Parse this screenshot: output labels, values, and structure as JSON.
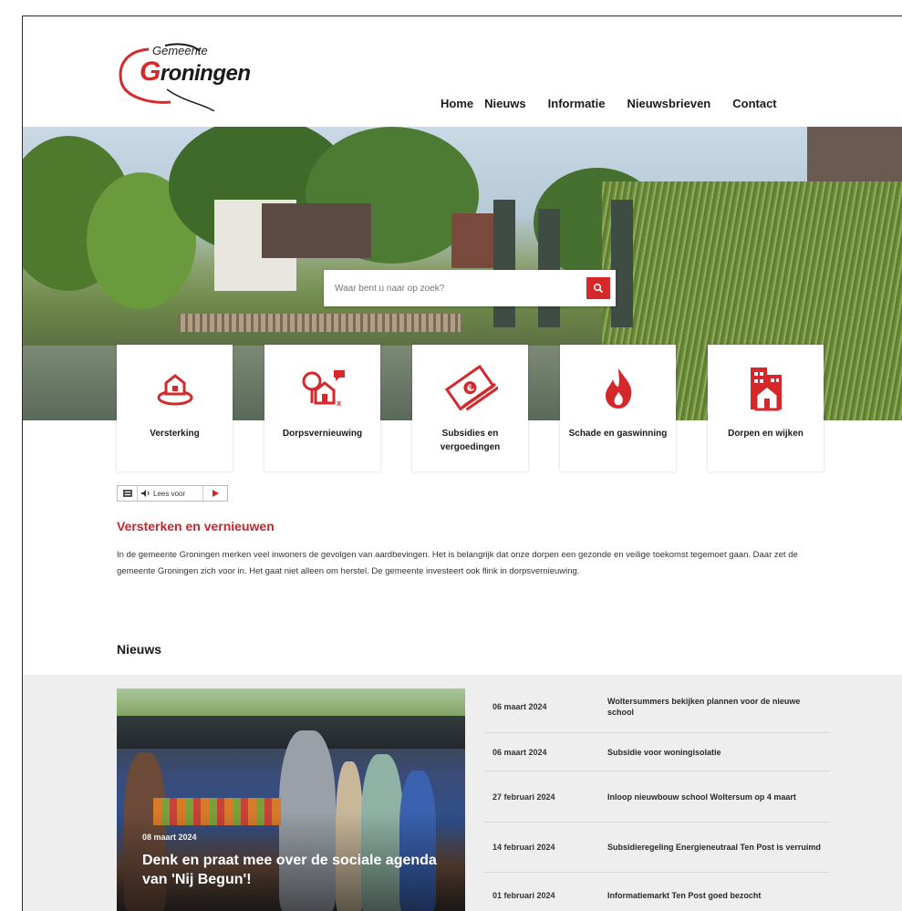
{
  "logo": {
    "sub": "Gemeente",
    "main_first": "G",
    "main_rest": "roningen"
  },
  "nav": [
    "Home",
    "Nieuws",
    "Informatie",
    "Nieuwsbrieven",
    "Contact"
  ],
  "search": {
    "placeholder": "Waar bent u naar op zoek?"
  },
  "tiles": [
    {
      "label": "Versterking",
      "icon": "house-shield-icon"
    },
    {
      "label": "Dorpsvernieuwing",
      "icon": "village-renewal-icon"
    },
    {
      "label": "Subsidies en vergoedingen",
      "icon": "euro-money-icon"
    },
    {
      "label": "Schade en gaswinning",
      "icon": "flame-icon"
    },
    {
      "label": "Dorpen en wijken",
      "icon": "buildings-icon"
    }
  ],
  "reader": {
    "label": "Lees voor"
  },
  "section": {
    "title": "Versterken en vernieuwen",
    "text": "In de gemeente Groningen merken veel inwoners de gevolgen van aardbevingen. Het is belangrijk dat onze dorpen een gezonde en veilige toekomst tegemoet gaan. Daar zet de gemeente Groningen zich voor in. Het gaat niet alleen om herstel. De gemeente investeert ook flink in dorpsvernieuwing."
  },
  "news": {
    "title": "Nieuws",
    "featured": {
      "date": "08 maart 2024",
      "title": "Denk en praat mee over de sociale agenda van 'Nij Begun'!"
    },
    "items": [
      {
        "date": "06 maart 2024",
        "title": "Woltersummers bekijken plannen voor de nieuwe school"
      },
      {
        "date": "06 maart 2024",
        "title": "Subsidie voor woningisolatie"
      },
      {
        "date": "27 februari 2024",
        "title": "Inloop nieuwbouw school Woltersum op 4 maart"
      },
      {
        "date": "14 februari 2024",
        "title": "Subsidieregeling Energieneutraal Ten Post is verruimd"
      },
      {
        "date": "01 februari 2024",
        "title": "Informatiemarkt Ten Post goed bezocht"
      }
    ]
  },
  "colors": {
    "accent": "#d6282b",
    "band": "#eeeeee"
  }
}
